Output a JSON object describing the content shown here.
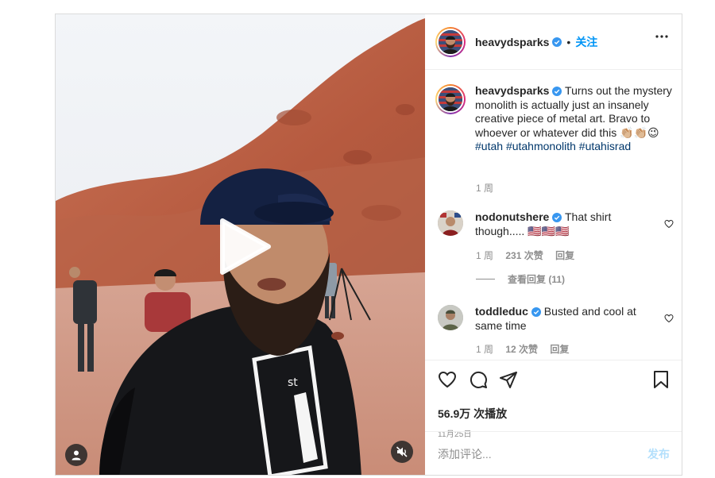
{
  "post": {
    "author": {
      "username": "heavydsparks",
      "verified": true,
      "separator": "•",
      "follow_label": "关注"
    },
    "caption": {
      "username": "heavydsparks",
      "text": "Turns out the mystery monolith is actually just an insanely creative piece of metal art. Bravo to whoever or whatever did this 👏🏼👏🏼😉",
      "hashtags": [
        "#utah",
        "#utahmonolith",
        "#utahisrad"
      ],
      "time": "1 周"
    },
    "comments": [
      {
        "username": "nodonutshere",
        "verified": true,
        "text": "That shirt though..... 🇺🇸🇺🇸🇺🇸",
        "time": "1 周",
        "likes": "231 次赞",
        "reply_label": "回复",
        "view_replies": "查看回复 (11)"
      },
      {
        "username": "toddleduc",
        "verified": true,
        "text": "Busted and cool at same time",
        "time": "1 周",
        "likes": "12 次赞",
        "reply_label": "回复"
      }
    ],
    "views": "56.9万 次播放",
    "date": "11月25日",
    "add_comment_placeholder": "添加评论...",
    "post_button": "发布"
  },
  "colors": {
    "verified": "#3897f0",
    "link": "#0095f6",
    "hashtag": "#00376b",
    "muted": "#8e8e8e"
  },
  "icons": {
    "like": "heart-icon",
    "comment": "comment-icon",
    "share": "paper-plane-icon",
    "save": "bookmark-icon",
    "more": "more-options-icon",
    "play": "play-icon",
    "mute": "muted-speaker-icon",
    "tag": "user-tag-icon"
  }
}
